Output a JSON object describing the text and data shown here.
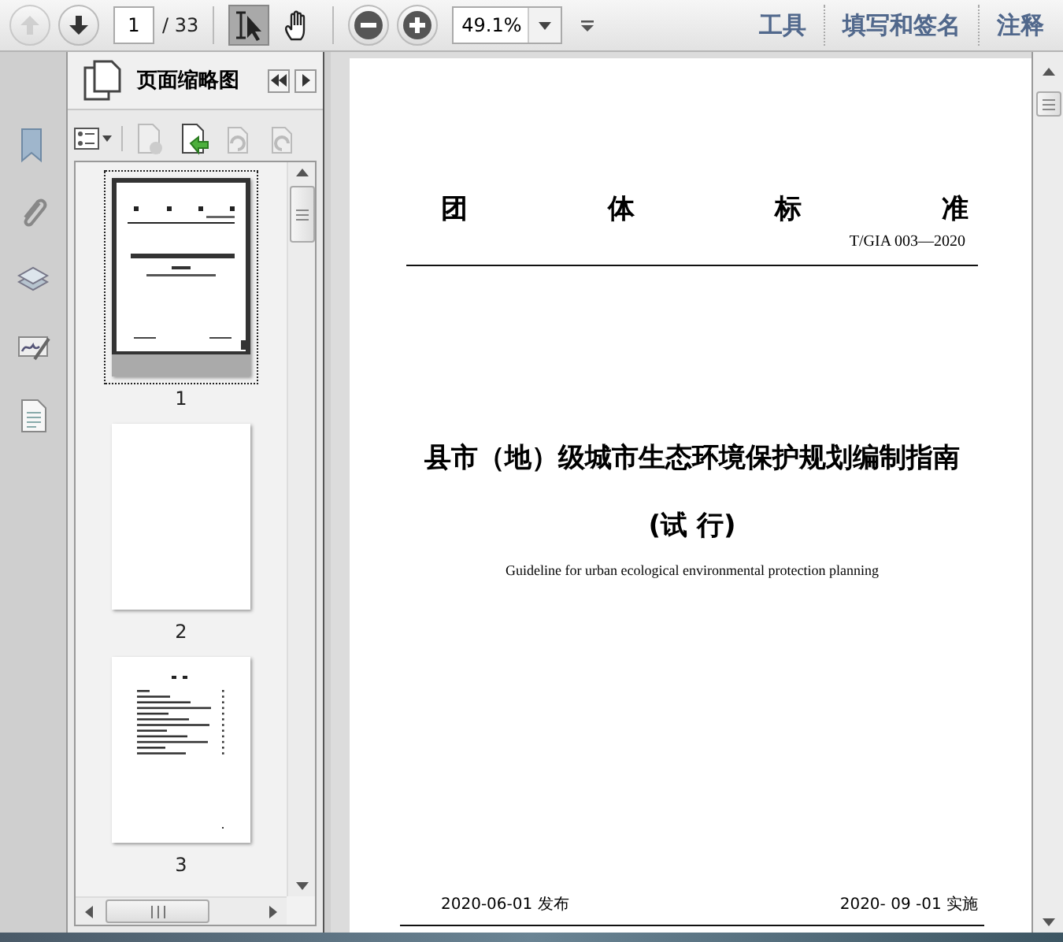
{
  "toolbar": {
    "nav": [
      {
        "kind": "up",
        "disabled": true
      },
      {
        "kind": "down",
        "disabled": false
      }
    ],
    "page_current": "1",
    "page_total": "/ 33",
    "tools": [
      {
        "kind": "select",
        "selected": true
      },
      {
        "kind": "hand",
        "selected": false
      }
    ],
    "zoom": "49.1%",
    "panels": [
      "工具",
      "填写和签名",
      "注释"
    ]
  },
  "sidebar": {
    "title": "页面缩略图",
    "rail": [
      {
        "kind": "bookmark"
      },
      {
        "kind": "paperclip"
      },
      {
        "kind": "layers"
      },
      {
        "kind": "signature"
      },
      {
        "kind": "document"
      }
    ],
    "thumbnails": [
      {
        "label": "1",
        "kind": "cover",
        "selected": true
      },
      {
        "label": "2",
        "kind": "blank",
        "selected": false
      },
      {
        "label": "3",
        "kind": "contents",
        "selected": false
      }
    ]
  },
  "document": {
    "header": [
      "团",
      "体",
      "标",
      "准"
    ],
    "code": "T/GIA  003—2020",
    "title": "县市（地）级城市生态环境保护规划编制指南",
    "subtitle": "(试 行)",
    "english": "Guideline for urban ecological environmental protection planning",
    "issued": "2020-06-01 发布",
    "effective": "2020- 09 -01  实施"
  }
}
